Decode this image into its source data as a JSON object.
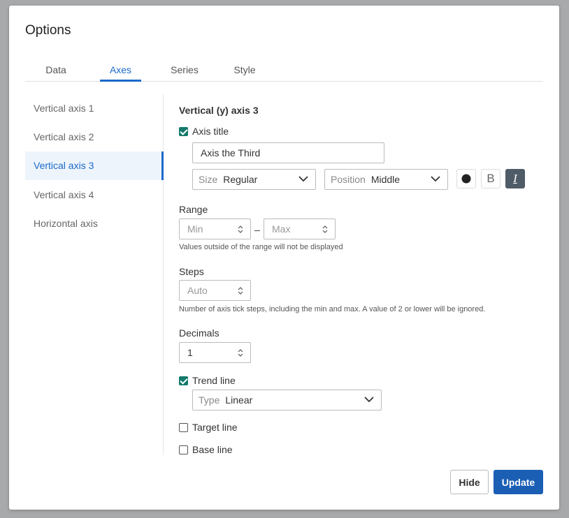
{
  "dialog": {
    "title": "Options"
  },
  "tabs": [
    {
      "label": "Data"
    },
    {
      "label": "Axes"
    },
    {
      "label": "Series"
    },
    {
      "label": "Style"
    }
  ],
  "sidebar": {
    "items": [
      {
        "label": "Vertical axis 1"
      },
      {
        "label": "Vertical axis 2"
      },
      {
        "label": "Vertical axis 3"
      },
      {
        "label": "Vertical axis 4"
      },
      {
        "label": "Horizontal axis"
      }
    ]
  },
  "axis": {
    "heading": "Vertical (y) axis 3",
    "axis_title": {
      "checkbox_label": "Axis title",
      "checked": true,
      "value": "Axis the Third",
      "size_label": "Size",
      "size_value": "Regular",
      "position_label": "Position",
      "position_value": "Middle",
      "bold_glyph": "B",
      "italic_glyph": "I"
    },
    "range": {
      "label": "Range",
      "min_placeholder": "Min",
      "max_placeholder": "Max",
      "separator": "–",
      "hint": "Values outside of the range will not be displayed"
    },
    "steps": {
      "label": "Steps",
      "placeholder": "Auto",
      "hint": "Number of axis tick steps, including the min and max. A value of 2 or lower will be ignored."
    },
    "decimals": {
      "label": "Decimals",
      "value": "1"
    },
    "trend_line": {
      "checkbox_label": "Trend line",
      "checked": true,
      "type_label": "Type",
      "type_value": "Linear"
    },
    "target_line": {
      "checkbox_label": "Target line",
      "checked": false
    },
    "base_line": {
      "checkbox_label": "Base line",
      "checked": false
    }
  },
  "footer": {
    "hide_label": "Hide",
    "update_label": "Update"
  },
  "colors": {
    "accent": "#1b6ac9",
    "checkbox": "#137a6b",
    "primary_button": "#1b5fb5",
    "italic_button": "#4f5b66"
  },
  "icons": {
    "chevron": "chevron-down-icon",
    "spinner": "spinner-arrows-icon",
    "color": "color-dot-icon"
  }
}
